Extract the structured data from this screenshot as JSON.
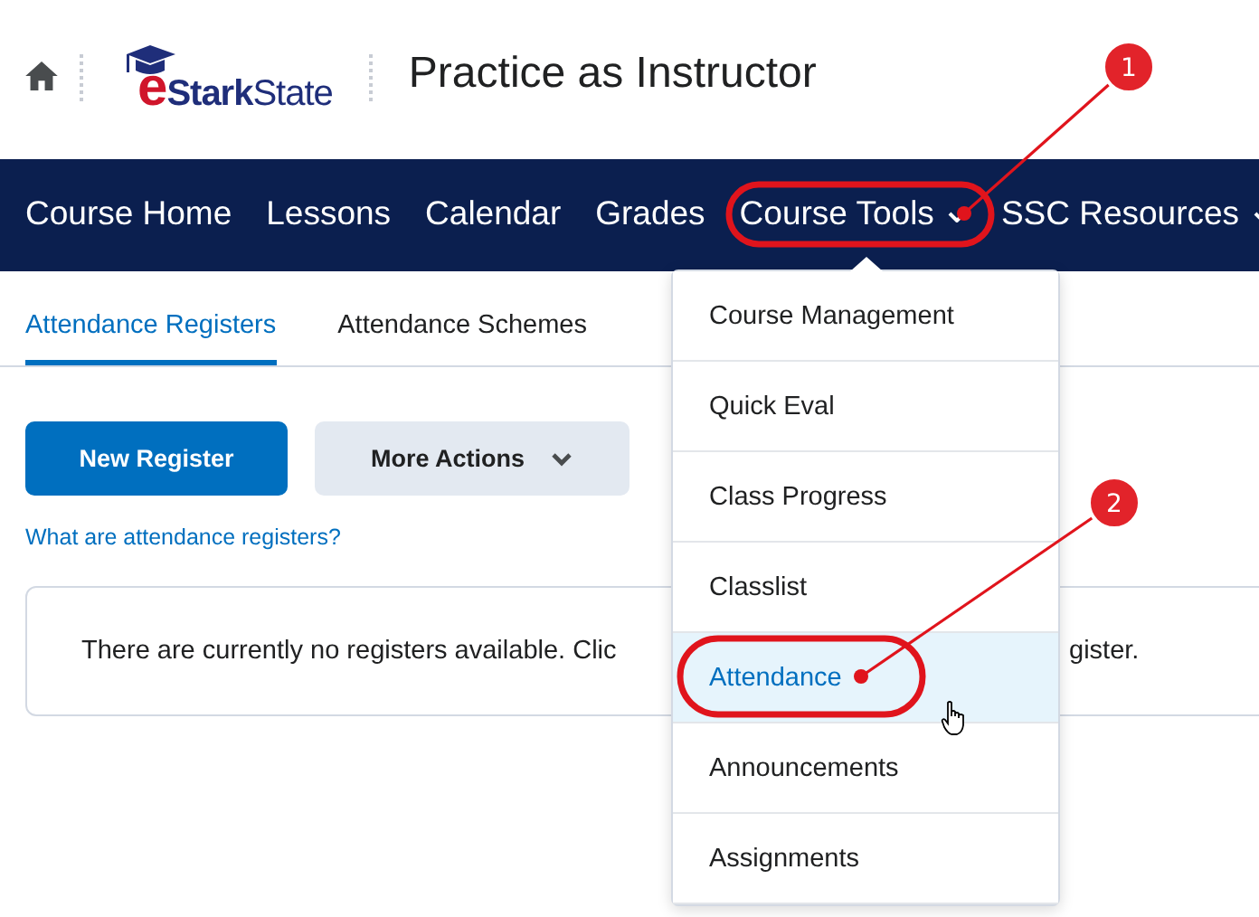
{
  "header": {
    "logo": "e**Stark**State",
    "title": "Practice as Instructor"
  },
  "nav": [
    {
      "label": "Course Home",
      "has_menu": false
    },
    {
      "label": "Lessons",
      "has_menu": false
    },
    {
      "label": "Calendar",
      "has_menu": false
    },
    {
      "label": "Grades",
      "has_menu": false
    },
    {
      "label": "Course Tools",
      "has_menu": true
    },
    {
      "label": "SSC Resources",
      "has_menu": true
    }
  ],
  "tabs": [
    {
      "label": "Attendance Registers",
      "selected": true
    },
    {
      "label": "Attendance Schemes",
      "selected": false
    }
  ],
  "buttons": [
    {
      "label": "New Register",
      "kind": "primary"
    },
    {
      "label": "More Actions",
      "kind": "menu"
    }
  ],
  "help_link": "What are attendance registers?",
  "empty_message": {
    "visible_start": "There are currently no registers available. Clic",
    "visible_end": "gister."
  },
  "dropdown": [
    {
      "label": "Course Management",
      "selected": false
    },
    {
      "label": "Quick Eval",
      "selected": false
    },
    {
      "label": "Class Progress",
      "selected": false
    },
    {
      "label": "Classlist",
      "selected": false
    },
    {
      "label": "Attendance",
      "selected": true
    },
    {
      "label": "Announcements",
      "selected": false
    },
    {
      "label": "Assignments",
      "selected": false
    }
  ],
  "callouts": [
    {
      "label": "1"
    },
    {
      "label": "2"
    }
  ]
}
